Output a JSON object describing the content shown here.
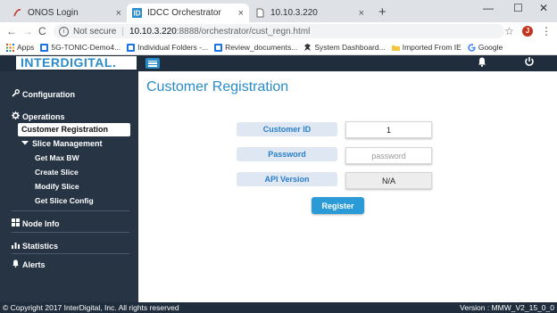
{
  "browser": {
    "tabs": [
      {
        "label": "ONOS Login",
        "icon": "onos-favicon",
        "active": false
      },
      {
        "label": "IDCC Orchestrator",
        "icon": "interdigital-favicon",
        "active": true
      },
      {
        "label": "10.10.3.220",
        "icon": "page-favicon",
        "active": false
      }
    ],
    "tab_close": "×",
    "new_tab": "+",
    "window_controls": {
      "minimize": "—",
      "maximize": "☐",
      "close": "✕"
    },
    "nav": {
      "back": "←",
      "forward": "→",
      "reload": "C"
    },
    "address": {
      "security_label": "Not secure",
      "host": "10.10.3.220",
      "path": ":8888/orchestrator/cust_regn.html"
    },
    "star": "☆",
    "avatar_letter": "J",
    "menu": "⋮",
    "bookmarks": [
      {
        "label": "Apps",
        "icon": "apps-grid-icon",
        "color": "#e04b2f"
      },
      {
        "label": "5G-TONIC-Demo4...",
        "icon": "site-icon",
        "color": "#1a73e8"
      },
      {
        "label": "Individual Folders -...",
        "icon": "folder-icon",
        "color": "#1a73e8"
      },
      {
        "label": "Review_documents...",
        "icon": "folder-icon",
        "color": "#1a73e8"
      },
      {
        "label": "System Dashboard...",
        "icon": "dashboard-icon",
        "color": "#333333"
      },
      {
        "label": "Imported From IE",
        "icon": "folder-icon",
        "color": "#f5c542"
      },
      {
        "label": "Google",
        "icon": "google-icon",
        "color": "#4285f4"
      }
    ]
  },
  "app": {
    "logo": "INTERDIGITAL.",
    "sidebar": {
      "configuration": "Configuration",
      "operations": "Operations",
      "customer_registration": "Customer Registration",
      "slice_management": "Slice Management",
      "slice_items": [
        "Get Max BW",
        "Create Slice",
        "Modify Slice",
        "Get Slice Config"
      ],
      "node_info": "Node Info",
      "statistics": "Statistics",
      "alerts": "Alerts"
    },
    "page_title": "Customer Registration",
    "form": {
      "customer_id_label": "Customer ID",
      "customer_id_value": "1",
      "password_label": "Password",
      "password_placeholder": "password",
      "api_version_label": "API Version",
      "api_version_value": "N/A",
      "register_label": "Register"
    },
    "footer": {
      "copyright": "© Copyright 2017 InterDigital, Inc. All rights reserved",
      "version": "Version : MMW_V2_15_0_0"
    },
    "colors": {
      "accent": "#2a8bc9",
      "sidebar": "#263444",
      "topbar": "#1f2d3d"
    }
  }
}
